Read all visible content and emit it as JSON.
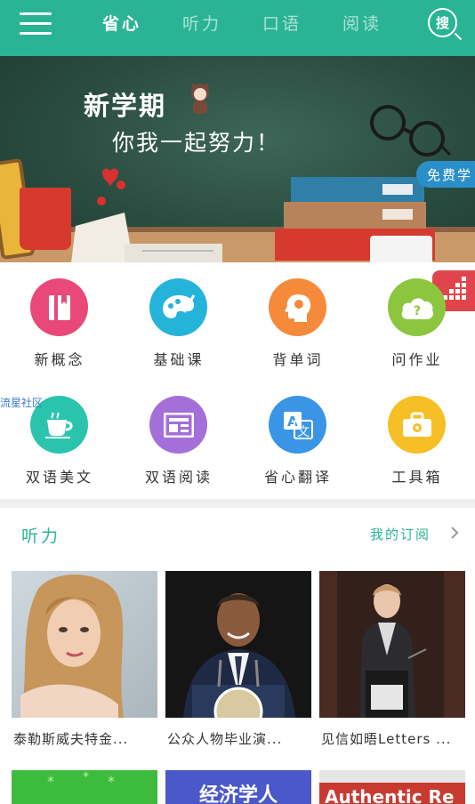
{
  "header": {
    "tabs": [
      {
        "label": "省心",
        "active": true
      },
      {
        "label": "听力",
        "active": false
      },
      {
        "label": "口语",
        "active": false
      },
      {
        "label": "阅读",
        "active": false
      }
    ],
    "search_label": "搜"
  },
  "banner": {
    "title": "新学期",
    "subtitle": "你我一起努力！",
    "free_badge": "免费学"
  },
  "grid": {
    "items": [
      {
        "label": "新概念",
        "icon": "book-icon",
        "color": "#e8497a"
      },
      {
        "label": "基础课",
        "icon": "palette-icon",
        "color": "#25b3d9"
      },
      {
        "label": "背单词",
        "icon": "head-icon",
        "color": "#f48a3a"
      },
      {
        "label": "问作业",
        "icon": "question-cloud-icon",
        "color": "#8cc63f"
      },
      {
        "label": "双语美文",
        "icon": "coffee-cup-icon",
        "color": "#2ac4ad"
      },
      {
        "label": "双语阅读",
        "icon": "newspaper-icon",
        "color": "#a46fd8"
      },
      {
        "label": "省心翻译",
        "icon": "translate-icon",
        "color": "#3a95e6"
      },
      {
        "label": "工具箱",
        "icon": "toolbox-icon",
        "color": "#f6bf26"
      }
    ],
    "community_link": "流星社区"
  },
  "section": {
    "title": "听力",
    "link": "我的订阅",
    "cards": [
      {
        "title": "泰勒斯威夫特金..."
      },
      {
        "title": "公众人物毕业演..."
      },
      {
        "title": "见信如晤Letters ..."
      }
    ],
    "next_row": [
      {
        "text": ""
      },
      {
        "text": "经济学人"
      },
      {
        "text": "Authentic Re"
      }
    ]
  },
  "colors": {
    "accent": "#2ab495",
    "float_widget": "#e0454b"
  }
}
